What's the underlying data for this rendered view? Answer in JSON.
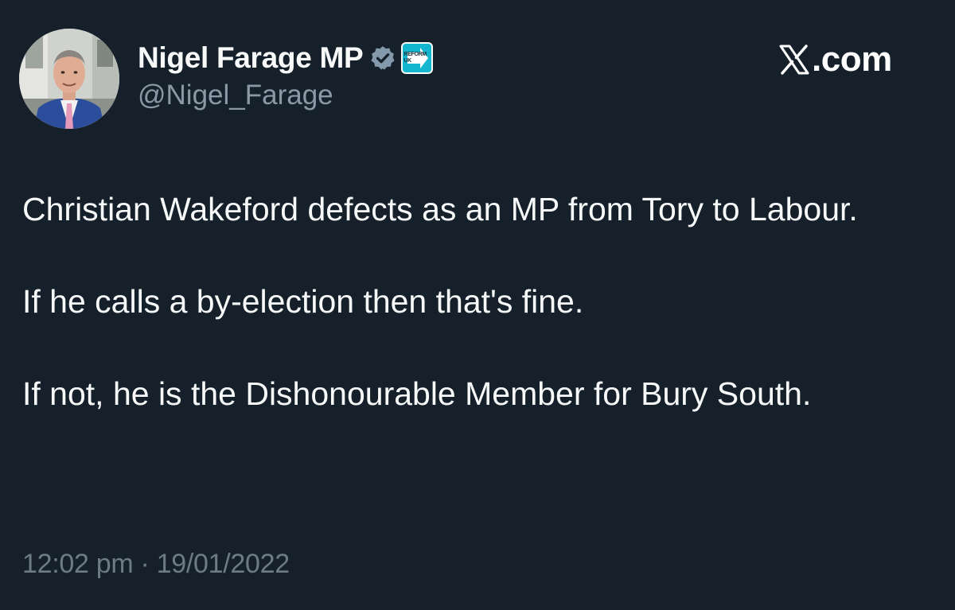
{
  "author": {
    "display_name": "Nigel Farage MP",
    "handle": "@Nigel_Farage",
    "verified_icon": "verified-badge-icon",
    "affiliate_badge": {
      "icon": "reform-uk-logo",
      "text": "REFORM UK",
      "color": "#12b6cf"
    }
  },
  "brand": {
    "label": ".com",
    "icon": "x-logo-icon"
  },
  "tweet": {
    "paragraphs": [
      "Christian Wakeford defects as an MP from Tory to Labour.",
      "If he calls a by-election then that's fine.",
      "If not, he is the Dishonourable Member for Bury South."
    ],
    "timestamp": "12:02 pm · 19/01/2022"
  },
  "colors": {
    "background": "#15202b",
    "text_primary": "#f7f9f9",
    "text_secondary": "#8b98a5"
  }
}
